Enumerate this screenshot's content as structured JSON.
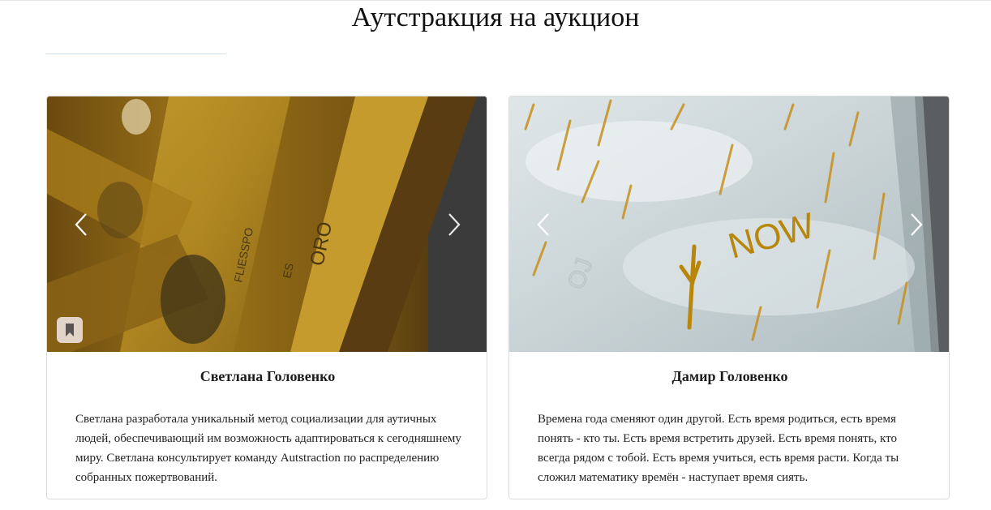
{
  "page": {
    "title": "Аутстракция на аукцион"
  },
  "cards": [
    {
      "artist": "Светлана Головенко",
      "description": "Светлана разработала уникальный метод социализации для аутичных людей, обеспечивающий им возможность адаптироваться к сегодняшнему миру. Светлана консультирует команду Autstraction по распределению собранных пожертвований.",
      "image_text": [
        "FLIESSPO",
        "ES",
        "ORO"
      ],
      "has_bookmark": true
    },
    {
      "artist": "Дамир Головенко",
      "description": "Времена года сменяют один другой. Есть время родиться, есть время понять - кто ты. Есть время встретить друзей. Есть время понять, кто всегда рядом с тобой. Есть время учиться, есть время расти. Когда ты сложил математику времён - наступает время сиять.",
      "image_text": [
        "NOW"
      ],
      "has_bookmark": false
    }
  ],
  "icons": {
    "prev": "chevron-left-icon",
    "next": "chevron-right-icon",
    "bookmark": "bookmark-icon"
  },
  "colors": {
    "border": "#dcdcdc",
    "title_rule": "#cfdde8",
    "bookmark_bg": "#ecdeda"
  }
}
